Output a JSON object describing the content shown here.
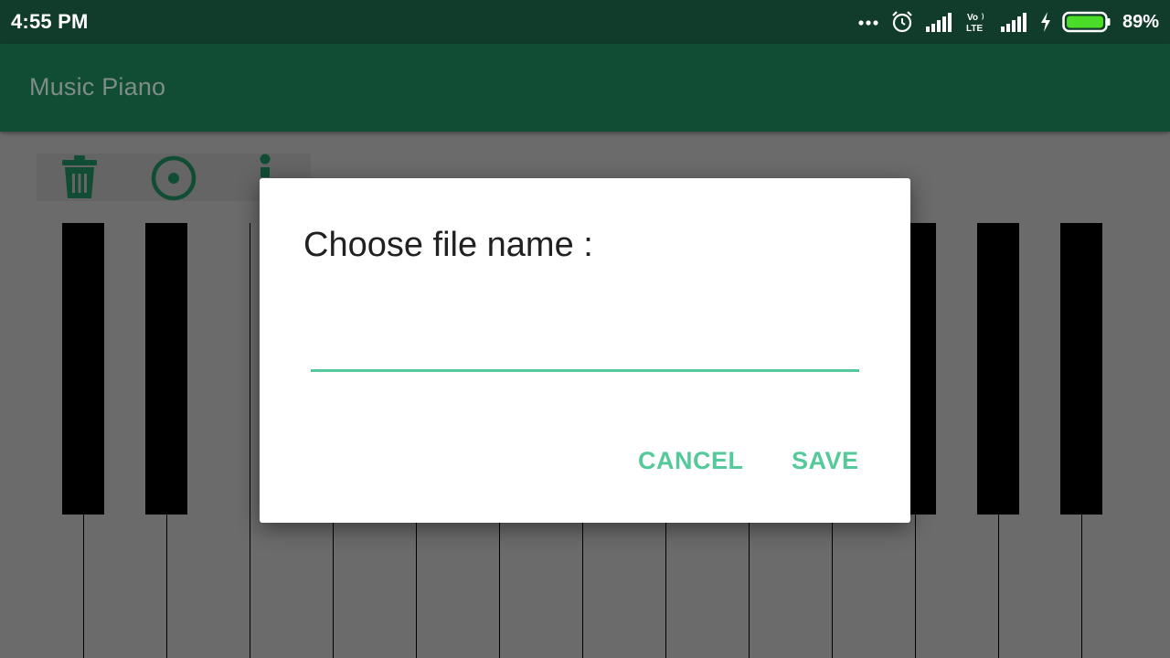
{
  "status_bar": {
    "time": "4:55 PM",
    "battery_percent": "89%",
    "icons": [
      "more-dots-icon",
      "alarm-icon",
      "signal-icon",
      "volte-icon",
      "signal-icon",
      "charging-bolt-icon",
      "battery-icon"
    ],
    "volte_text": "Vo LTE"
  },
  "app_bar": {
    "title": "Music Piano"
  },
  "toolbar": {
    "icons": [
      "trash-icon",
      "record-icon",
      "more-vert-icon"
    ]
  },
  "piano": {
    "white_key_count": 14,
    "black_key_count": 11
  },
  "dialog": {
    "title": "Choose file name :",
    "input_value": "",
    "input_placeholder": "",
    "cancel_label": "CANCEL",
    "save_label": "SAVE"
  },
  "colors": {
    "status_bar": "#113c2b",
    "app_bar": "#104d34",
    "accent": "#55c99a",
    "scrim_background": "#6b6b6b",
    "icon_green": "#104d34"
  }
}
